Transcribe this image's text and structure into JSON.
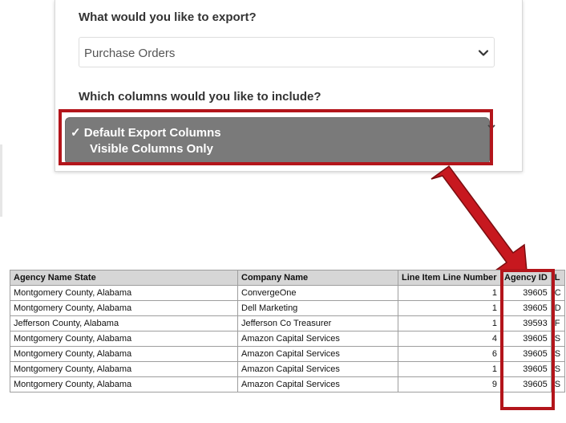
{
  "export_panel": {
    "question_export": "What would you like to export?",
    "export_select_value": "Purchase Orders",
    "question_columns": "Which columns would you like to include?",
    "column_options": [
      {
        "label": "✓ Default Export Columns",
        "selected": true
      },
      {
        "label": "Visible Columns Only",
        "selected": false
      }
    ]
  },
  "highlight_color": "#b3151b",
  "table": {
    "headers": [
      "Agency Name State",
      "Company Name",
      "Line Item Line Number",
      "Agency ID",
      "L"
    ],
    "rows": [
      [
        "Montgomery County, Alabama",
        "ConvergeOne",
        "1",
        "39605",
        "C"
      ],
      [
        "Montgomery County, Alabama",
        "Dell Marketing",
        "1",
        "39605",
        "D"
      ],
      [
        "Jefferson County, Alabama",
        "Jefferson Co Treasurer",
        "1",
        "39593",
        "F"
      ],
      [
        "Montgomery County, Alabama",
        "Amazon Capital Services",
        "4",
        "39605",
        "S"
      ],
      [
        "Montgomery County, Alabama",
        "Amazon Capital Services",
        "6",
        "39605",
        "S"
      ],
      [
        "Montgomery County, Alabama",
        "Amazon Capital Services",
        "1",
        "39605",
        "S"
      ],
      [
        "Montgomery County, Alabama",
        "Amazon Capital Services",
        "9",
        "39605",
        "S"
      ]
    ]
  }
}
